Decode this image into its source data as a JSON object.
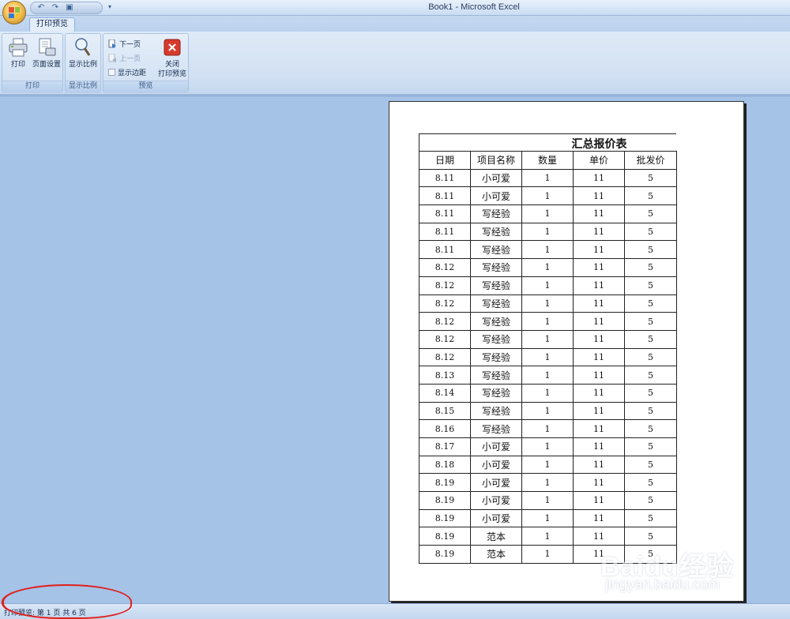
{
  "window": {
    "title": "Book1 - Microsoft Excel"
  },
  "qat": {
    "undo_icon": "undo-icon",
    "redo_icon": "redo-icon",
    "preview_icon": "print-preview-icon"
  },
  "ribbon": {
    "active_tab": "打印预览",
    "groups": {
      "print": {
        "label": "打印",
        "print_button": "打印",
        "page_setup_button": "页面设置"
      },
      "zoom": {
        "label": "显示比例",
        "zoom_button": "显示比例"
      },
      "preview": {
        "label": "预览",
        "next_page": "下一页",
        "prev_page": "上一页",
        "show_margins": "显示边距",
        "close_preview_line1": "关闭",
        "close_preview_line2": "打印预览"
      }
    }
  },
  "sheet": {
    "title": "汇总报价表",
    "headers": [
      "日期",
      "项目名称",
      "数量",
      "单价",
      "批发价"
    ],
    "rows": [
      [
        "8.11",
        "小可爱",
        "1",
        "11",
        "5"
      ],
      [
        "8.11",
        "小可爱",
        "1",
        "11",
        "5"
      ],
      [
        "8.11",
        "写经验",
        "1",
        "11",
        "5"
      ],
      [
        "8.11",
        "写经验",
        "1",
        "11",
        "5"
      ],
      [
        "8.11",
        "写经验",
        "1",
        "11",
        "5"
      ],
      [
        "8.12",
        "写经验",
        "1",
        "11",
        "5"
      ],
      [
        "8.12",
        "写经验",
        "1",
        "11",
        "5"
      ],
      [
        "8.12",
        "写经验",
        "1",
        "11",
        "5"
      ],
      [
        "8.12",
        "写经验",
        "1",
        "11",
        "5"
      ],
      [
        "8.12",
        "写经验",
        "1",
        "11",
        "5"
      ],
      [
        "8.12",
        "写经验",
        "1",
        "11",
        "5"
      ],
      [
        "8.13",
        "写经验",
        "1",
        "11",
        "5"
      ],
      [
        "8.14",
        "写经验",
        "1",
        "11",
        "5"
      ],
      [
        "8.15",
        "写经验",
        "1",
        "11",
        "5"
      ],
      [
        "8.16",
        "写经验",
        "1",
        "11",
        "5"
      ],
      [
        "8.17",
        "小可爱",
        "1",
        "11",
        "5"
      ],
      [
        "8.18",
        "小可爱",
        "1",
        "11",
        "5"
      ],
      [
        "8.19",
        "小可爱",
        "1",
        "11",
        "5"
      ],
      [
        "8.19",
        "小可爱",
        "1",
        "11",
        "5"
      ],
      [
        "8.19",
        "小可爱",
        "1",
        "11",
        "5"
      ],
      [
        "8.19",
        "范本",
        "1",
        "11",
        "5"
      ],
      [
        "8.19",
        "范本",
        "1",
        "11",
        "5"
      ]
    ]
  },
  "status": {
    "text": "打印预览: 第 1 页  共 6 页"
  },
  "watermark": {
    "main": "Baidu经验",
    "sub": "jingyan.baidu.com"
  },
  "colors": {
    "annotation": "#e0201d",
    "close_icon": "#d83a2e",
    "workarea": "#a5c2e7"
  }
}
